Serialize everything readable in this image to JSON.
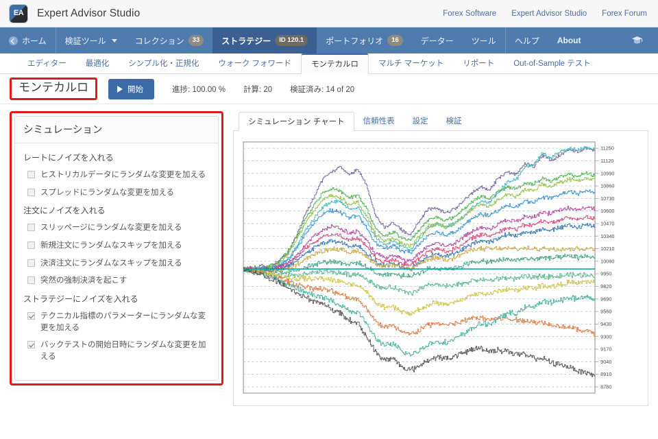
{
  "app": {
    "logo_text": "EA",
    "title": "Expert Advisor Studio"
  },
  "topbar": {
    "links": [
      {
        "label": "Forex Software",
        "name": "link-forex-software"
      },
      {
        "label": "Expert Advisor Studio",
        "name": "link-expert-advisor-studio"
      },
      {
        "label": "Forex Forum",
        "name": "link-forex-forum"
      }
    ]
  },
  "mainnav": {
    "items": [
      {
        "label": "ホーム",
        "icon": "home-icon",
        "badge": null,
        "caret": false,
        "active": false
      },
      {
        "label": "検証ツール",
        "icon": null,
        "badge": null,
        "caret": true,
        "active": false
      },
      {
        "label": "コレクション",
        "icon": null,
        "badge": "33",
        "caret": false,
        "active": false
      },
      {
        "label": "ストラテジー",
        "icon": null,
        "badge": "ID 120.1",
        "caret": false,
        "active": true
      },
      {
        "label": "ポートフォリオ",
        "icon": null,
        "badge": "16",
        "caret": false,
        "active": false
      },
      {
        "label": "データー",
        "icon": null,
        "badge": null,
        "caret": false,
        "active": false
      },
      {
        "label": "ツール",
        "icon": null,
        "badge": null,
        "caret": false,
        "active": false
      },
      {
        "label": "ヘルプ",
        "icon": null,
        "badge": null,
        "caret": false,
        "active": false
      },
      {
        "label": "About",
        "icon": null,
        "badge": null,
        "caret": false,
        "active": false
      }
    ],
    "right_icon": "graduation-cap-icon"
  },
  "tabstrip": {
    "tabs": [
      {
        "label": "エディター",
        "active": false
      },
      {
        "label": "最適化",
        "active": false
      },
      {
        "label": "シンプル化・正規化",
        "active": false
      },
      {
        "label": "ウォーク フォワード",
        "active": false
      },
      {
        "label": "モンテカルロ",
        "active": true
      },
      {
        "label": "マルチ マーケット",
        "active": false
      },
      {
        "label": "リポート",
        "active": false
      },
      {
        "label": "Out-of-Sample テスト",
        "active": false
      }
    ]
  },
  "actionrow": {
    "page_title": "モンテカルロ",
    "start_label": "開始",
    "stats": [
      {
        "label": "進捗: 100.00 %",
        "name": "stat-progress"
      },
      {
        "label": "計算: 20",
        "name": "stat-calculations"
      },
      {
        "label": "検証済み: 14 of 20",
        "name": "stat-validated"
      }
    ]
  },
  "sidebar": {
    "heading": "シミュレーション",
    "groups": [
      {
        "title": "レートにノイズを入れる",
        "options": [
          {
            "label": "ヒストリカルデータにランダムな変更を加える",
            "checked": false
          },
          {
            "label": "スプレッドにランダムな変更を加える",
            "checked": false
          }
        ]
      },
      {
        "title": "注文にノイズを入れる",
        "options": [
          {
            "label": "スリッページにランダムな変更を加える",
            "checked": false
          },
          {
            "label": "新規注文にランダムなスキップを加える",
            "checked": false
          },
          {
            "label": "決済注文にランダムなスキップを加える",
            "checked": false
          },
          {
            "label": "突然の強制決済を起こす",
            "checked": false
          }
        ]
      },
      {
        "title": "ストラテジーにノイズを入れる",
        "options": [
          {
            "label": "テクニカル指標のパラメーターにランダムな変更を加える",
            "checked": true
          },
          {
            "label": "バックテストの開始日時にランダムな変更を加える",
            "checked": true
          }
        ]
      }
    ]
  },
  "charttabs": {
    "tabs": [
      {
        "label": "シミュレーション チャート",
        "active": true
      },
      {
        "label": "信頼性表",
        "active": false
      },
      {
        "label": "設定",
        "active": false
      },
      {
        "label": "検証",
        "active": false
      }
    ]
  },
  "highlight_color": "#dd1b18",
  "chart_data": {
    "type": "line",
    "title": "シミュレーション チャート",
    "xlabel": "",
    "ylabel": "",
    "grid": true,
    "legend": "none",
    "ylim": [
      8715,
      11315
    ],
    "yticks": [
      11250,
      11120,
      10990,
      10860,
      10730,
      10600,
      10470,
      10340,
      10210,
      10080,
      9950,
      9820,
      9690,
      9560,
      9430,
      9300,
      9170,
      9040,
      8910,
      8780
    ],
    "baseline": 10000,
    "baseline_color": "#00a0a0",
    "x": [
      0,
      1,
      2,
      3,
      4,
      5,
      6,
      7,
      8,
      9,
      10,
      11,
      12,
      13,
      14,
      15,
      16,
      17,
      18,
      19,
      20,
      21,
      22,
      23,
      24,
      25,
      26,
      27,
      28,
      29,
      30,
      31,
      32,
      33,
      34,
      35,
      36,
      37,
      38,
      39,
      40
    ],
    "series": [
      {
        "name": "sim-01",
        "color": "#6f5fa0",
        "values": [
          10010,
          9990,
          10040,
          10020,
          10080,
          10160,
          10340,
          10560,
          10740,
          10930,
          11000,
          11060,
          10980,
          11030,
          10860,
          10560,
          10430,
          10480,
          10400,
          10360,
          10500,
          10620,
          10630,
          10580,
          10620,
          10700,
          10790,
          10850,
          10820,
          10940,
          11000,
          10980,
          11090,
          11060,
          11180,
          11120,
          11180,
          11230,
          11210,
          11250,
          11230
        ]
      },
      {
        "name": "sim-02",
        "color": "#3fb6bf",
        "values": [
          10000,
          10010,
          9990,
          10010,
          10030,
          10100,
          10230,
          10400,
          10520,
          10640,
          10700,
          10700,
          10620,
          10640,
          10500,
          10330,
          10250,
          10290,
          10230,
          10200,
          10310,
          10430,
          10470,
          10430,
          10470,
          10540,
          10640,
          10700,
          10690,
          10800,
          10900,
          10920,
          11060,
          11080,
          11200,
          11150,
          11220,
          11250,
          11230,
          11260,
          11240
        ]
      },
      {
        "name": "sim-03",
        "color": "#49b04a",
        "values": [
          10000,
          10020,
          10000,
          10040,
          10070,
          10180,
          10330,
          10520,
          10660,
          10790,
          10830,
          10810,
          10740,
          10760,
          10620,
          10420,
          10340,
          10380,
          10320,
          10300,
          10410,
          10510,
          10540,
          10500,
          10540,
          10620,
          10700,
          10750,
          10730,
          10800,
          10850,
          10830,
          10890,
          10880,
          10940,
          10910,
          10950,
          10980,
          10960,
          10990,
          10970
        ]
      },
      {
        "name": "sim-04",
        "color": "#8fbf3f",
        "values": [
          9990,
          10000,
          9980,
          10010,
          10050,
          10150,
          10300,
          10470,
          10600,
          10720,
          10760,
          10740,
          10670,
          10690,
          10550,
          10360,
          10290,
          10320,
          10260,
          10240,
          10340,
          10440,
          10470,
          10430,
          10470,
          10540,
          10620,
          10670,
          10650,
          10720,
          10770,
          10750,
          10820,
          10810,
          10880,
          10850,
          10900,
          10930,
          10910,
          10940,
          10920
        ]
      },
      {
        "name": "sim-05",
        "color": "#2f8fd0",
        "values": [
          10000,
          9990,
          10010,
          10000,
          10030,
          10090,
          10210,
          10360,
          10470,
          10570,
          10610,
          10590,
          10530,
          10550,
          10430,
          10270,
          10210,
          10240,
          10190,
          10170,
          10260,
          10350,
          10380,
          10350,
          10390,
          10450,
          10520,
          10570,
          10550,
          10610,
          10660,
          10640,
          10700,
          10690,
          10750,
          10730,
          10770,
          10800,
          10780,
          10810,
          10790
        ]
      },
      {
        "name": "sim-06",
        "color": "#b03fa0",
        "values": [
          10000,
          10010,
          9990,
          10000,
          10020,
          10060,
          10140,
          10250,
          10340,
          10410,
          10440,
          10420,
          10370,
          10390,
          10290,
          10160,
          10110,
          10140,
          10100,
          10080,
          10160,
          10240,
          10270,
          10240,
          10270,
          10330,
          10390,
          10430,
          10410,
          10470,
          10510,
          10490,
          10550,
          10540,
          10590,
          10570,
          10610,
          10630,
          10610,
          10640,
          10620
        ]
      },
      {
        "name": "sim-07",
        "color": "#d43f6f",
        "values": [
          9990,
          10000,
          9980,
          9990,
          10010,
          10040,
          10110,
          10210,
          10280,
          10340,
          10360,
          10340,
          10300,
          10320,
          10230,
          10110,
          10070,
          10100,
          10060,
          10040,
          10110,
          10180,
          10210,
          10180,
          10210,
          10260,
          10320,
          10360,
          10340,
          10390,
          10430,
          10410,
          10460,
          10450,
          10500,
          10480,
          10510,
          10530,
          10510,
          10540,
          10520
        ]
      },
      {
        "name": "sim-08",
        "color": "#2e6fb0",
        "values": [
          10000,
          9990,
          10000,
          9980,
          10000,
          10020,
          10080,
          10160,
          10220,
          10270,
          10290,
          10270,
          10230,
          10250,
          10170,
          10070,
          10030,
          10060,
          10020,
          10000,
          10070,
          10130,
          10160,
          10130,
          10160,
          10210,
          10260,
          10300,
          10280,
          10320,
          10360,
          10340,
          10390,
          10380,
          10420,
          10400,
          10430,
          10450,
          10430,
          10460,
          10440
        ]
      },
      {
        "name": "sim-09",
        "color": "#c8a63f",
        "values": [
          10000,
          10000,
          9990,
          9980,
          9990,
          10000,
          10040,
          10100,
          10150,
          10190,
          10210,
          10200,
          10170,
          10190,
          10130,
          10050,
          10020,
          10040,
          10010,
          10000,
          10050,
          10100,
          10120,
          10100,
          10120,
          10160,
          10200,
          10210,
          10210,
          10210,
          10210,
          10210,
          10210,
          10210,
          10210,
          10210,
          10210,
          10210,
          10210,
          10210,
          10210
        ]
      },
      {
        "name": "sim-10",
        "color": "#3f9f7f",
        "values": [
          10000,
          9990,
          9980,
          9970,
          9970,
          9970,
          9990,
          10020,
          10050,
          10070,
          10080,
          10070,
          10050,
          10060,
          10020,
          9960,
          9940,
          9950,
          9930,
          9920,
          9960,
          10000,
          10010,
          10000,
          10010,
          10040,
          10070,
          10080,
          10070,
          10090,
          10100,
          10090,
          10110,
          10100,
          10120,
          10110,
          10120,
          10130,
          10120,
          10130,
          10120
        ]
      },
      {
        "name": "sim-11",
        "color": "#55b48e",
        "values": [
          9990,
          9980,
          9960,
          9940,
          9930,
          9920,
          9930,
          9950,
          9960,
          9970,
          9970,
          9960,
          9940,
          9950,
          9900,
          9830,
          9800,
          9810,
          9770,
          9750,
          9790,
          9830,
          9840,
          9820,
          9830,
          9850,
          9880,
          9890,
          9880,
          9900,
          9910,
          9900,
          9920,
          9910,
          9930,
          9920,
          9930,
          9940,
          9930,
          9940,
          9930
        ]
      },
      {
        "name": "sim-12",
        "color": "#cfc03f",
        "values": [
          10000,
          9990,
          9970,
          9950,
          9930,
          9910,
          9900,
          9900,
          9900,
          9900,
          9890,
          9870,
          9840,
          9840,
          9760,
          9650,
          9600,
          9610,
          9560,
          9530,
          9580,
          9630,
          9650,
          9630,
          9650,
          9690,
          9730,
          9750,
          9740,
          9770,
          9790,
          9780,
          9810,
          9800,
          9830,
          9820,
          9840,
          9860,
          9850,
          9870,
          9860
        ]
      },
      {
        "name": "sim-13",
        "color": "#d9773f",
        "values": [
          10000,
          9980,
          9960,
          9930,
          9900,
          9870,
          9840,
          9820,
          9800,
          9790,
          9770,
          9740,
          9700,
          9690,
          9590,
          9460,
          9400,
          9410,
          9350,
          9320,
          9370,
          9420,
          9440,
          9420,
          9430,
          9460,
          9490,
          9500,
          9480,
          9490,
          9490,
          9470,
          9470,
          9450,
          9450,
          9420,
          9410,
          9400,
          9370,
          9360,
          9330
        ]
      },
      {
        "name": "sim-14",
        "color": "#3fae9a",
        "values": [
          10000,
          9980,
          9950,
          9920,
          9880,
          9840,
          9800,
          9760,
          9730,
          9700,
          9670,
          9630,
          9570,
          9550,
          9430,
          9280,
          9210,
          9220,
          9150,
          9110,
          9160,
          9220,
          9250,
          9240,
          9270,
          9330,
          9390,
          9430,
          9430,
          9490,
          9540,
          9540,
          9600,
          9610,
          9660,
          9650,
          9680,
          9700,
          9690,
          9710,
          9690
        ]
      },
      {
        "name": "sim-15",
        "color": "#4f4f4f",
        "values": [
          10000,
          9970,
          9940,
          9900,
          9860,
          9810,
          9760,
          9710,
          9670,
          9630,
          9590,
          9540,
          9470,
          9440,
          9300,
          9140,
          9060,
          9070,
          8990,
          8950,
          9000,
          9060,
          9090,
          9070,
          9090,
          9130,
          9170,
          9180,
          9150,
          9160,
          9150,
          9120,
          9110,
          9080,
          9070,
          9030,
          9010,
          8990,
          8950,
          8930,
          8890
        ]
      }
    ]
  }
}
